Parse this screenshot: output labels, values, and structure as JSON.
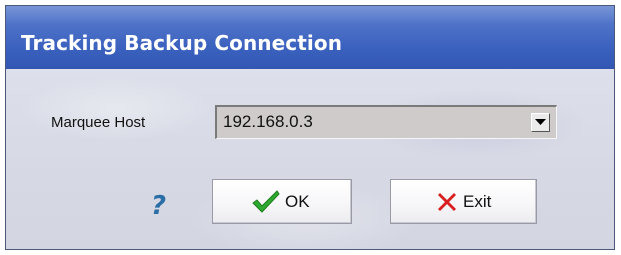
{
  "window": {
    "title": "Tracking Backup Connection"
  },
  "form": {
    "host_label": "Marquee Host",
    "host_value": "192.168.0.3"
  },
  "buttons": {
    "ok_label": "OK",
    "exit_label": "Exit"
  },
  "icons": {
    "help": "question-mark-icon",
    "ok": "green-checkmark-icon",
    "exit": "red-x-icon",
    "dropdown": "down-arrow-icon"
  },
  "colors": {
    "titlebar": "#3b62bf",
    "check": "#2ea82e",
    "cross": "#d81e1e",
    "help": "#2b6ea6"
  }
}
